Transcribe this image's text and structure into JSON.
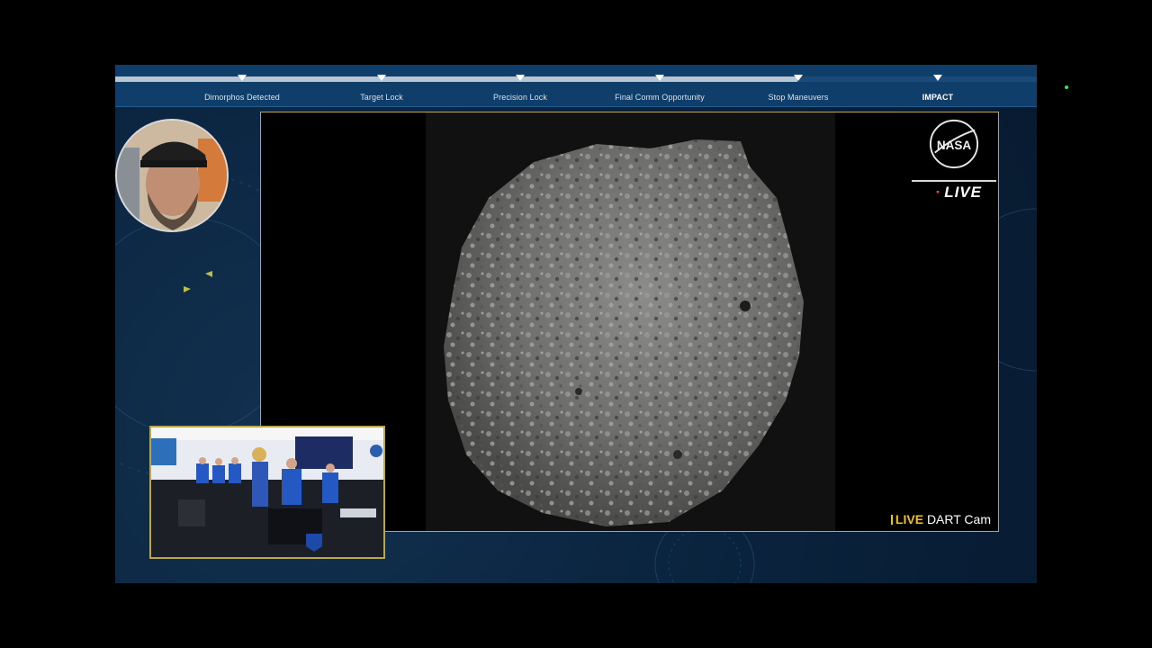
{
  "timeline": {
    "milestones": [
      {
        "label": "Dimorphos Detected"
      },
      {
        "label": "Target Lock"
      },
      {
        "label": "Precision Lock"
      },
      {
        "label": "Final Comm Opportunity"
      },
      {
        "label": "Stop Maneuvers"
      },
      {
        "label": "IMPACT"
      }
    ],
    "progress": 0.74
  },
  "feed": {
    "logo_text": "NASA",
    "live_badge": "LIVE",
    "cam_live": "LIVE",
    "cam_name": "DART Cam"
  },
  "colors": {
    "frame_border": "#b9a74e",
    "timeline_bg": "#0f3e6b",
    "live_accent": "#f2c21b",
    "nasa_red": "#e24b3a"
  },
  "icons": [
    "nasa-logo-icon",
    "apl-logo-icon"
  ]
}
